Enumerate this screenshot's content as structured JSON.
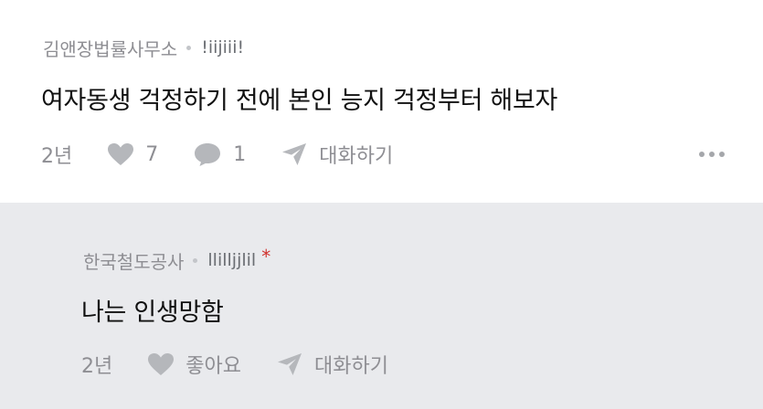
{
  "comment": {
    "author": "김앤장법률사무소",
    "nickname": "!iijiii!",
    "text": "여자동생 걱정하기 전에 본인 능지 걱정부터 해보자",
    "time": "2년",
    "likes": "7",
    "replies": "1",
    "chat_label": "대화하기"
  },
  "reply": {
    "author": "한국철도공사",
    "nickname": "llilljjlil",
    "author_mark": "*",
    "text": "나는 인생망함",
    "time": "2년",
    "like_label": "좋아요",
    "chat_label": "대화하기"
  },
  "colors": {
    "reply_bg": "#e9eaed",
    "meta_text": "#8e8e93",
    "icon": "#b5b7bb",
    "author_mark": "#d0312d"
  },
  "icons": [
    "heart-icon",
    "speech-bubble-icon",
    "send-icon",
    "more-icon"
  ]
}
